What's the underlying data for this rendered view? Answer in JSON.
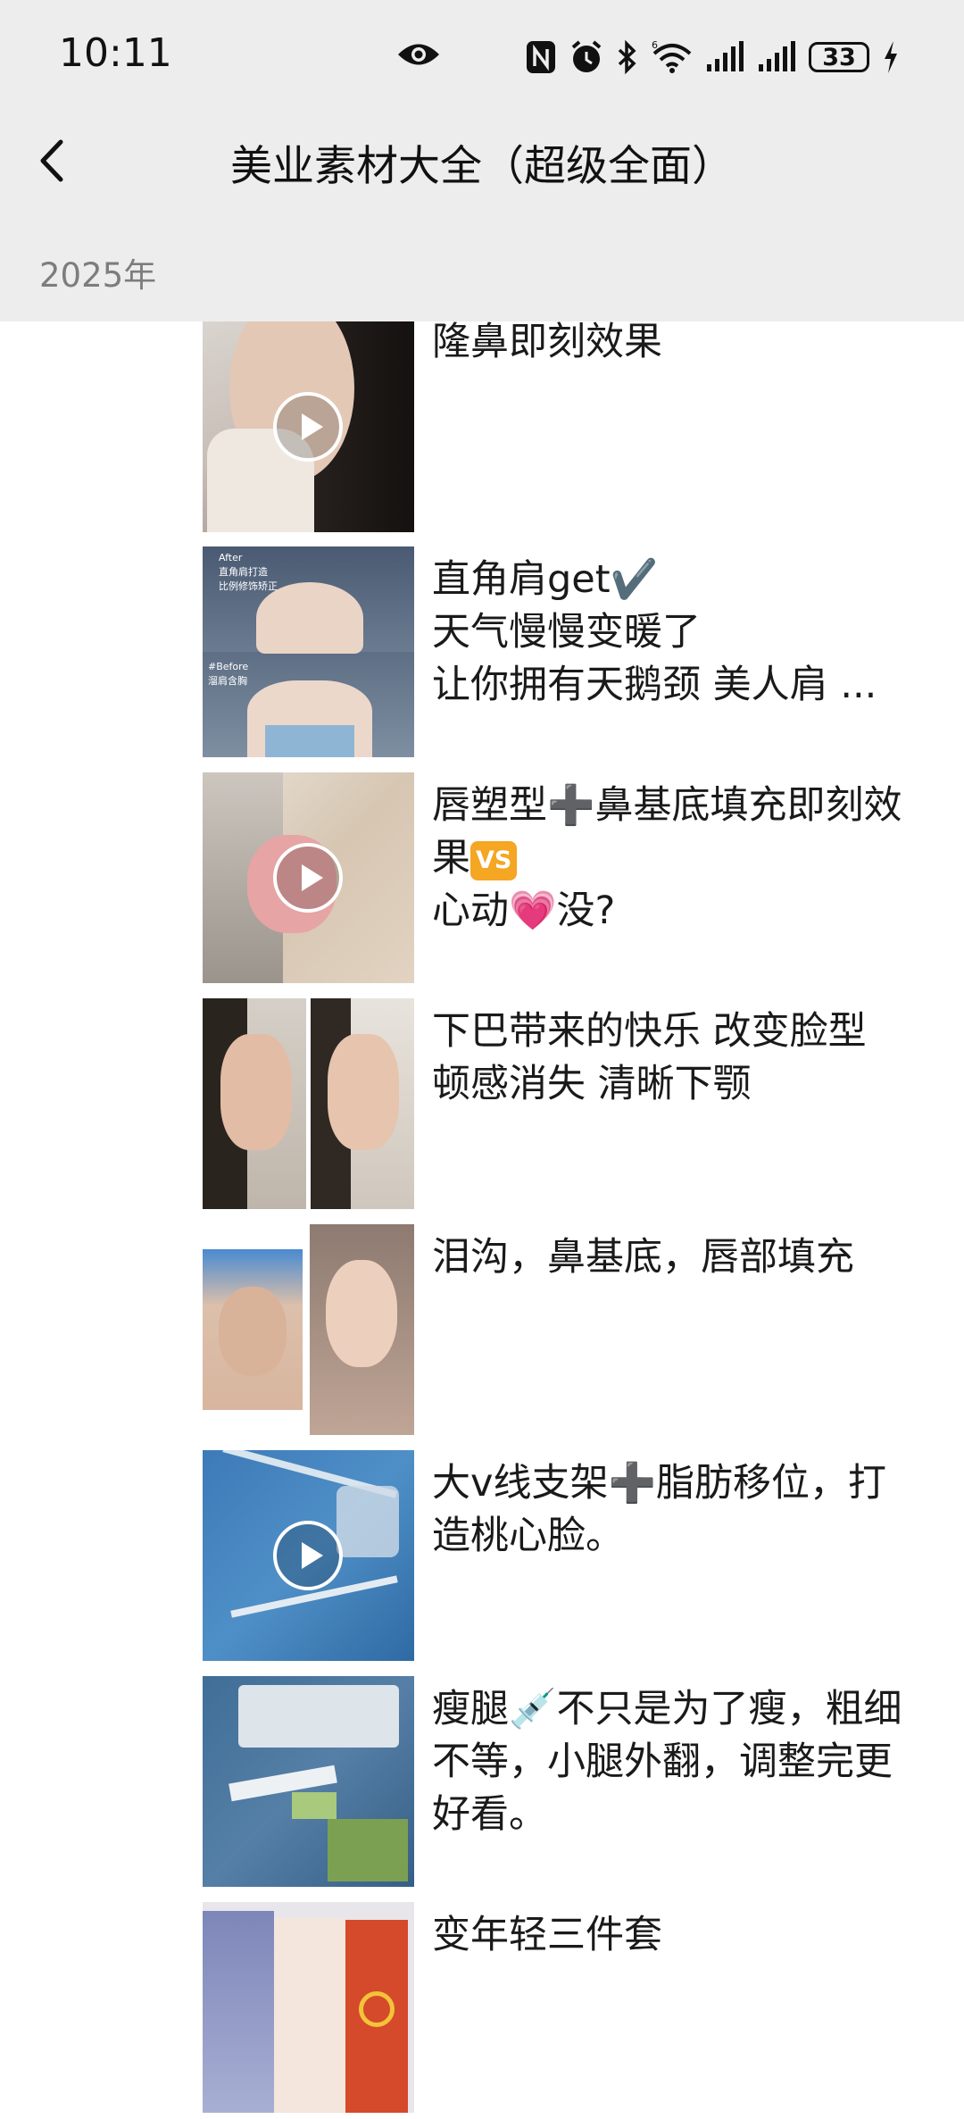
{
  "status": {
    "time": "10:11",
    "battery": "33",
    "icons": [
      "eye-icon",
      "nfc-icon",
      "alarm-icon",
      "bluetooth-icon",
      "wifi-icon",
      "signal-icon",
      "signal-icon",
      "battery-icon",
      "charging-icon"
    ]
  },
  "nav": {
    "back_icon": "chevron-left-icon",
    "title": "美业素材大全（超级全面）"
  },
  "section": {
    "year": "2025年"
  },
  "items": [
    {
      "lines": [
        "隆鼻即刻效果"
      ],
      "video": true
    },
    {
      "lines": [
        "直角肩get✔️",
        "天气慢慢变暖了",
        "让你拥有天鹅颈 美人肩 ..."
      ],
      "video": false,
      "captions": [
        "After",
        "直角肩打造",
        "比例修饰矫正",
        "#Before",
        "溜肩含胸"
      ]
    },
    {
      "lines": [
        "唇塑型➕鼻基底填充即刻效",
        "果",
        "心动",
        "没?"
      ],
      "badge": "VS",
      "heart": "💗",
      "video": true
    },
    {
      "lines": [
        "下巴带来的快乐 改变脸型",
        "顿感消失 清晰下颚"
      ],
      "video": false
    },
    {
      "lines": [
        "泪沟，鼻基底，唇部填充"
      ],
      "video": false
    },
    {
      "lines": [
        "大v线支架➕脂肪移位，打",
        "造桃心脸。"
      ],
      "video": true
    },
    {
      "lines": [
        "瘦腿💉不只是为了瘦，粗细",
        "不等，小腿外翻，调整完更",
        "好看。"
      ],
      "video": false
    },
    {
      "lines": [
        "变年轻三件套"
      ],
      "video": false
    }
  ],
  "colors": {
    "header_bg": "#ededed",
    "year_text": "#7d7d7d",
    "badge": "#f5a623"
  }
}
